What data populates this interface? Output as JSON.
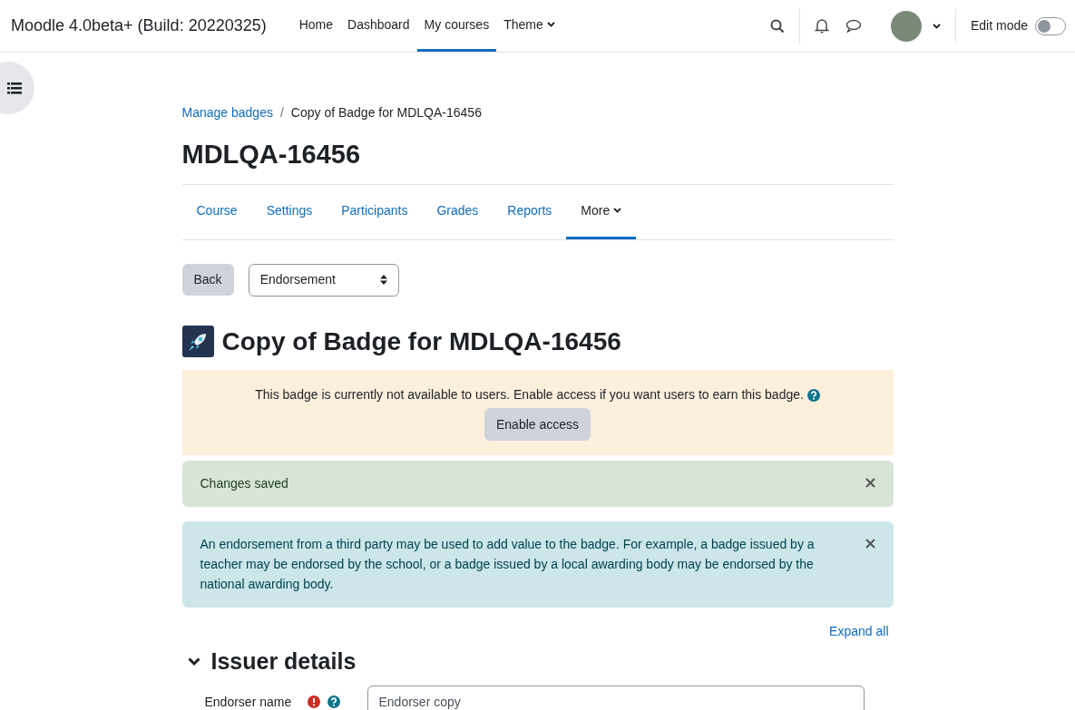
{
  "navbar": {
    "site_name": "Moodle 4.0beta+ (Build: 20220325)",
    "links": [
      {
        "label": "Home",
        "selected": false,
        "has_caret": false
      },
      {
        "label": "Dashboard",
        "selected": false,
        "has_caret": false
      },
      {
        "label": "My courses",
        "selected": true,
        "has_caret": false
      },
      {
        "label": "Theme",
        "selected": false,
        "has_caret": true
      }
    ],
    "edit_mode": {
      "label": "Edit mode",
      "on": false
    }
  },
  "breadcrumb": [
    {
      "label": "Manage badges",
      "kind": "link"
    },
    {
      "label": "/",
      "kind": "separator"
    },
    {
      "label": "Copy of Badge for MDLQA-16456",
      "kind": "current"
    }
  ],
  "course_title": "MDLQA-16456",
  "secondary_nav": [
    {
      "label": "Course",
      "selected": false,
      "has_caret": false
    },
    {
      "label": "Settings",
      "selected": false,
      "has_caret": false
    },
    {
      "label": "Participants",
      "selected": false,
      "has_caret": false
    },
    {
      "label": "Grades",
      "selected": false,
      "has_caret": false
    },
    {
      "label": "Reports",
      "selected": false,
      "has_caret": false
    },
    {
      "label": "More",
      "selected": true,
      "has_caret": true
    }
  ],
  "action_bar": {
    "back_button": "Back",
    "select": "Endorsement"
  },
  "badge_title": "Copy of Badge for MDLQA-16456",
  "alerts": [
    {
      "kind": "warning",
      "text": "This badge is currently not available to users. Enable access if you want users to earn this badge.",
      "help": true,
      "button": "Enable access",
      "dismissible": false
    },
    {
      "kind": "success",
      "text": "Changes saved",
      "help": false,
      "dismissible": true
    },
    {
      "kind": "info",
      "text": "An endorsement from a third party may be used to add value to the badge. For example, a badge issued by a teacher may be endorsed by the school, or a badge issued by a local awarding body may be endorsed by the national awarding body.",
      "help": false,
      "dismissible": true
    }
  ],
  "expand_all": "Expand all",
  "section": {
    "title": "Issuer details",
    "expanded": true,
    "fields": [
      {
        "label": "Endorser name",
        "required": true,
        "help": true,
        "value": "Endorser copy"
      }
    ]
  }
}
